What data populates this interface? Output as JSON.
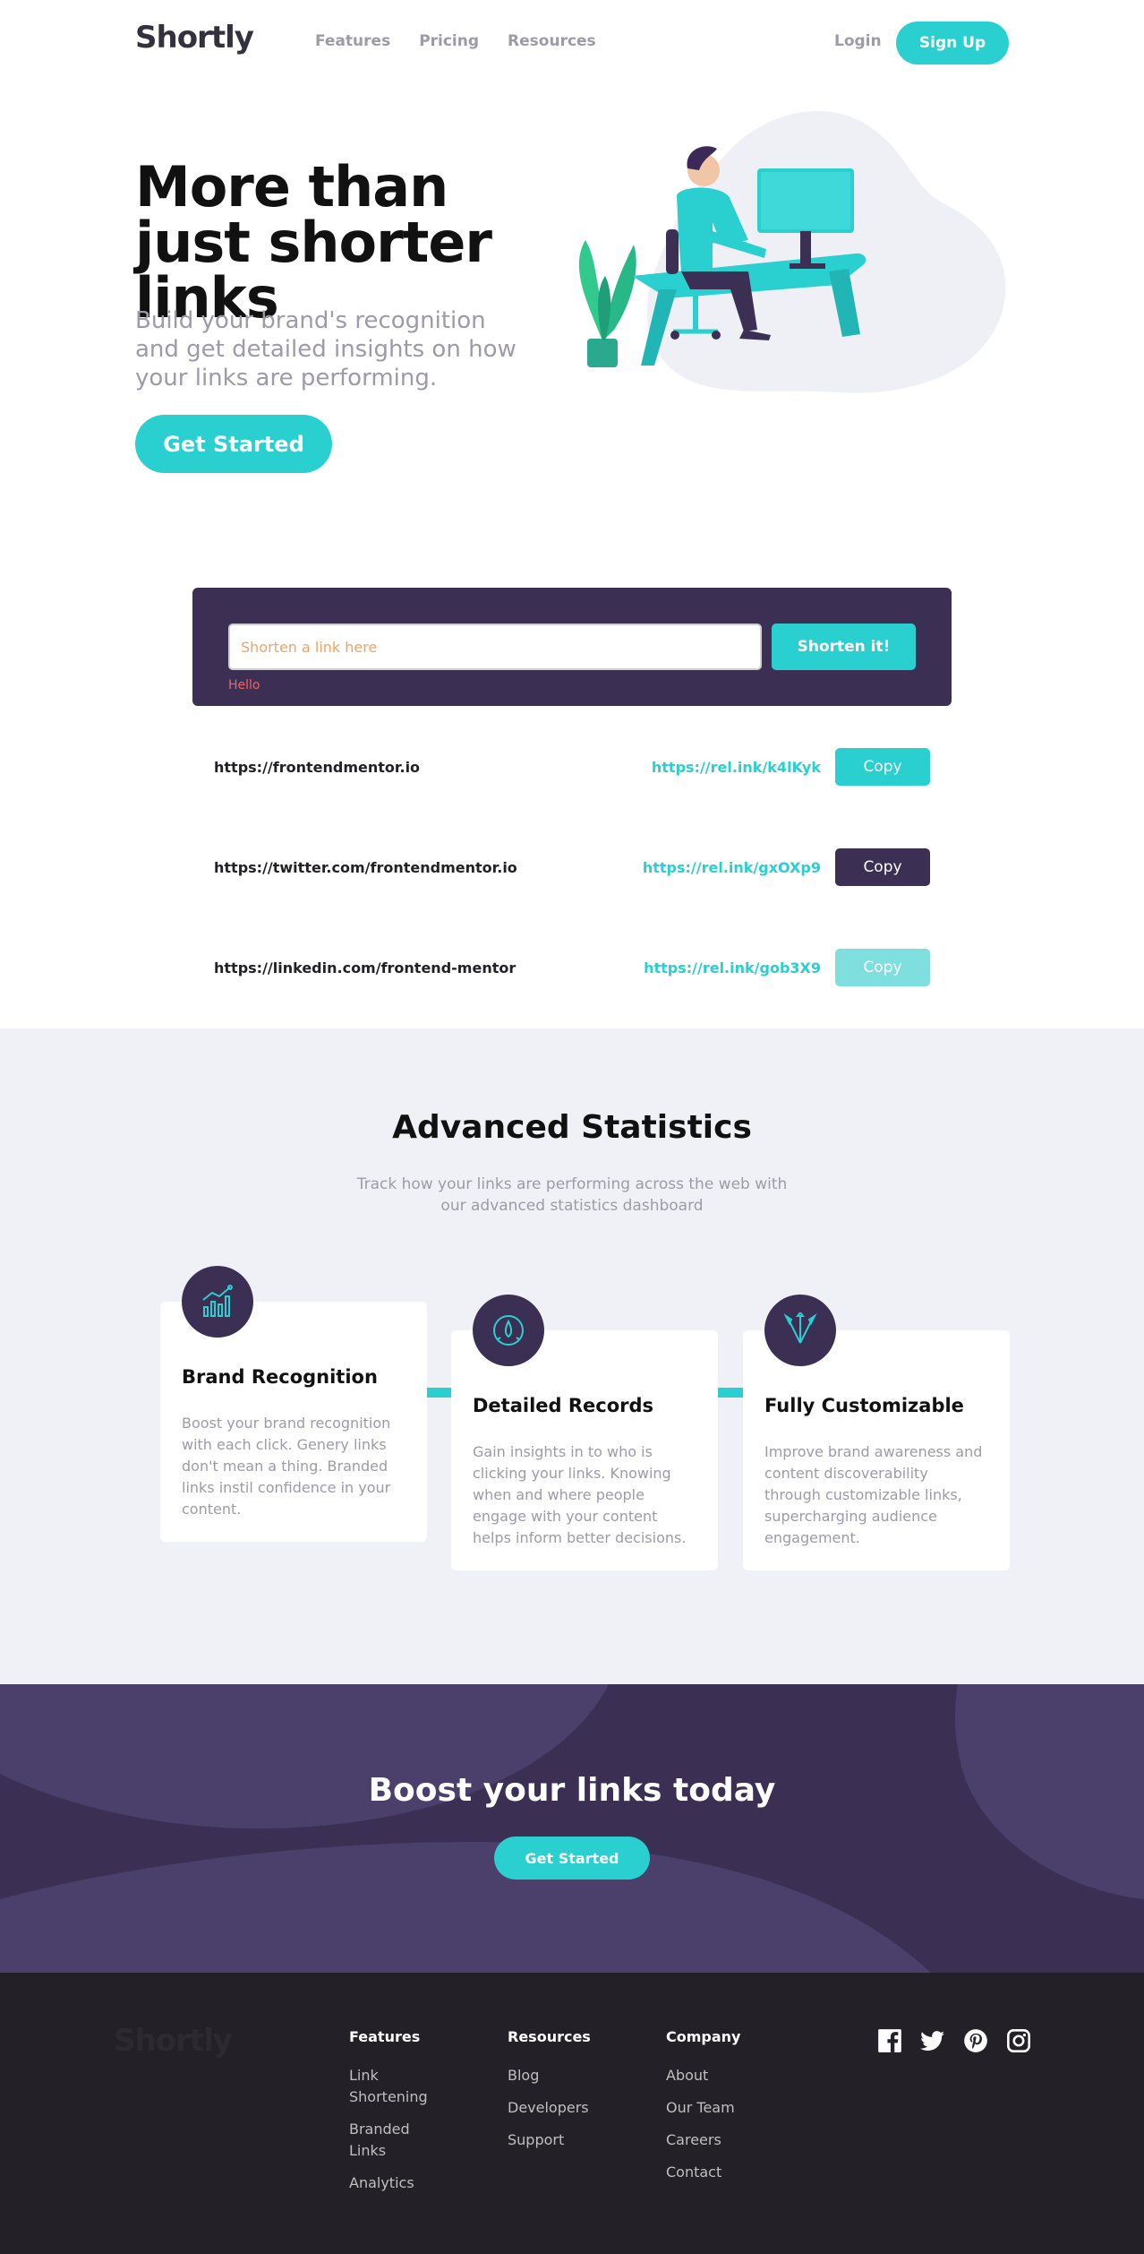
{
  "header": {
    "logo": "Shortly",
    "nav": [
      "Features",
      "Pricing",
      "Resources"
    ],
    "login": "Login",
    "signup": "Sign Up"
  },
  "hero": {
    "title": "More than just shorter links",
    "subtitle": "Build your brand's recognition and get detailed insights on how your links are performing.",
    "cta": "Get Started"
  },
  "shorten": {
    "placeholder": "Shorten a link here",
    "button": "Shorten it!",
    "error": "Hello"
  },
  "results": [
    {
      "original": "https://frontendmentor.io",
      "short": "https://rel.ink/k4lKyk",
      "copy": "Copy",
      "state": "default"
    },
    {
      "original": "https://twitter.com/frontendmentor.io",
      "short": "https://rel.ink/gxOXp9",
      "copy": "Copy",
      "state": "copied"
    },
    {
      "original": "https://linkedin.com/frontend-mentor",
      "short": "https://rel.ink/gob3X9",
      "copy": "Copy",
      "state": "faded"
    }
  ],
  "stats": {
    "title": "Advanced Statistics",
    "subtitle": "Track how your links are performing across the web with our advanced statistics dashboard",
    "cards": [
      {
        "title": "Brand Recognition",
        "text": "Boost your brand recognition with each click. Genery links don't mean a thing. Branded links instil confidence in your content.",
        "icon": "chart-icon"
      },
      {
        "title": "Detailed Records",
        "text": "Gain insights in to who is clicking your links. Knowing when and where people engage with your content helps inform better decisions.",
        "icon": "gauge-icon"
      },
      {
        "title": "Fully Customizable",
        "text": "Improve brand awareness and content discoverability through customizable links, supercharging audience engagement.",
        "icon": "brush-icon"
      }
    ]
  },
  "boost": {
    "title": "Boost your links today",
    "cta": "Get Started"
  },
  "footer": {
    "logo": "Shortly",
    "columns": [
      {
        "heading": "Features",
        "links": [
          "Link Shortening",
          "Branded Links",
          "Analytics"
        ]
      },
      {
        "heading": "Resources",
        "links": [
          "Blog",
          "Developers",
          "Support"
        ]
      },
      {
        "heading": "Company",
        "links": [
          "About",
          "Our Team",
          "Careers",
          "Contact"
        ]
      }
    ],
    "socials": [
      "facebook-icon",
      "twitter-icon",
      "pinterest-icon",
      "instagram-icon"
    ]
  },
  "colors": {
    "accent": "#2acfcf",
    "dark_violet": "#3b3054",
    "footer_bg": "#232127",
    "error": "#f46262",
    "grey_text": "#9e9aa7"
  }
}
